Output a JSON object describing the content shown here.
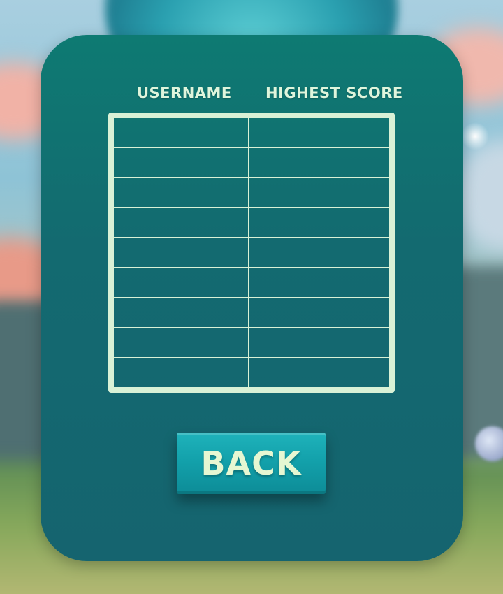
{
  "leaderboard": {
    "headers": {
      "username": "USERNAME",
      "highest_score": "HIGHEST SCORE"
    },
    "rows": [
      {
        "username": "",
        "score": ""
      },
      {
        "username": "",
        "score": ""
      },
      {
        "username": "",
        "score": ""
      },
      {
        "username": "",
        "score": ""
      },
      {
        "username": "",
        "score": ""
      },
      {
        "username": "",
        "score": ""
      },
      {
        "username": "",
        "score": ""
      },
      {
        "username": "",
        "score": ""
      },
      {
        "username": "",
        "score": ""
      }
    ]
  },
  "back_button": {
    "label": "BACK"
  },
  "colors": {
    "panel": "#136a70",
    "table_border": "#d9f1d6",
    "button": "#13a1ab",
    "text": "#dff5dc"
  }
}
